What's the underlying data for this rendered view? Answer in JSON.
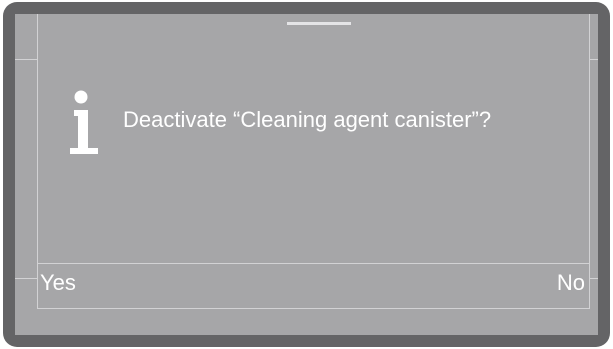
{
  "dialog": {
    "icon": "info-icon",
    "message": "Deactivate “Cleaning agent canister”?"
  },
  "softkeys": {
    "yes_label": "Yes",
    "no_label": "No"
  },
  "colors": {
    "bezel": "#646466",
    "screen": "#a6a6a8",
    "text": "#ffffff"
  }
}
